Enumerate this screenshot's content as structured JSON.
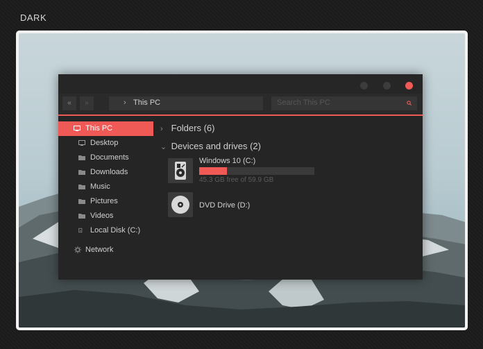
{
  "theme_label": "DARK",
  "colors": {
    "accent": "#ef5a57",
    "window_bg": "#252526",
    "frame": "#f3f3f3"
  },
  "window": {
    "controls": [
      "minimize-button",
      "maximize-button",
      "close-button"
    ],
    "nav": {
      "back_glyph": "«",
      "forward_glyph": "»"
    },
    "address": {
      "chevron": "›",
      "path": "This PC"
    },
    "search": {
      "placeholder": "Search This PC",
      "icon": "search-icon"
    }
  },
  "sidebar": {
    "items": [
      {
        "label": "This PC",
        "icon": "computer-icon",
        "selected": true
      },
      {
        "label": "Desktop",
        "icon": "monitor-icon"
      },
      {
        "label": "Documents",
        "icon": "folder-icon"
      },
      {
        "label": "Downloads",
        "icon": "folder-icon"
      },
      {
        "label": "Music",
        "icon": "folder-icon"
      },
      {
        "label": "Pictures",
        "icon": "folder-icon"
      },
      {
        "label": "Videos",
        "icon": "folder-icon"
      },
      {
        "label": "Local Disk (C:)",
        "icon": "disk-icon"
      },
      {
        "label": "Network",
        "icon": "network-icon"
      }
    ]
  },
  "content": {
    "folders_header": "Folders (6)",
    "devices_header": "Devices and drives (2)",
    "collapsed_arrow": "›",
    "expanded_arrow": "⌄",
    "drives": [
      {
        "name": "Windows 10 (C:)",
        "free_text": "45.3 GB free of 59.9 GB",
        "used_fraction": 0.24,
        "icon": "hard-drive-icon"
      },
      {
        "name": "DVD Drive (D:)",
        "icon": "dvd-drive-icon"
      }
    ]
  }
}
